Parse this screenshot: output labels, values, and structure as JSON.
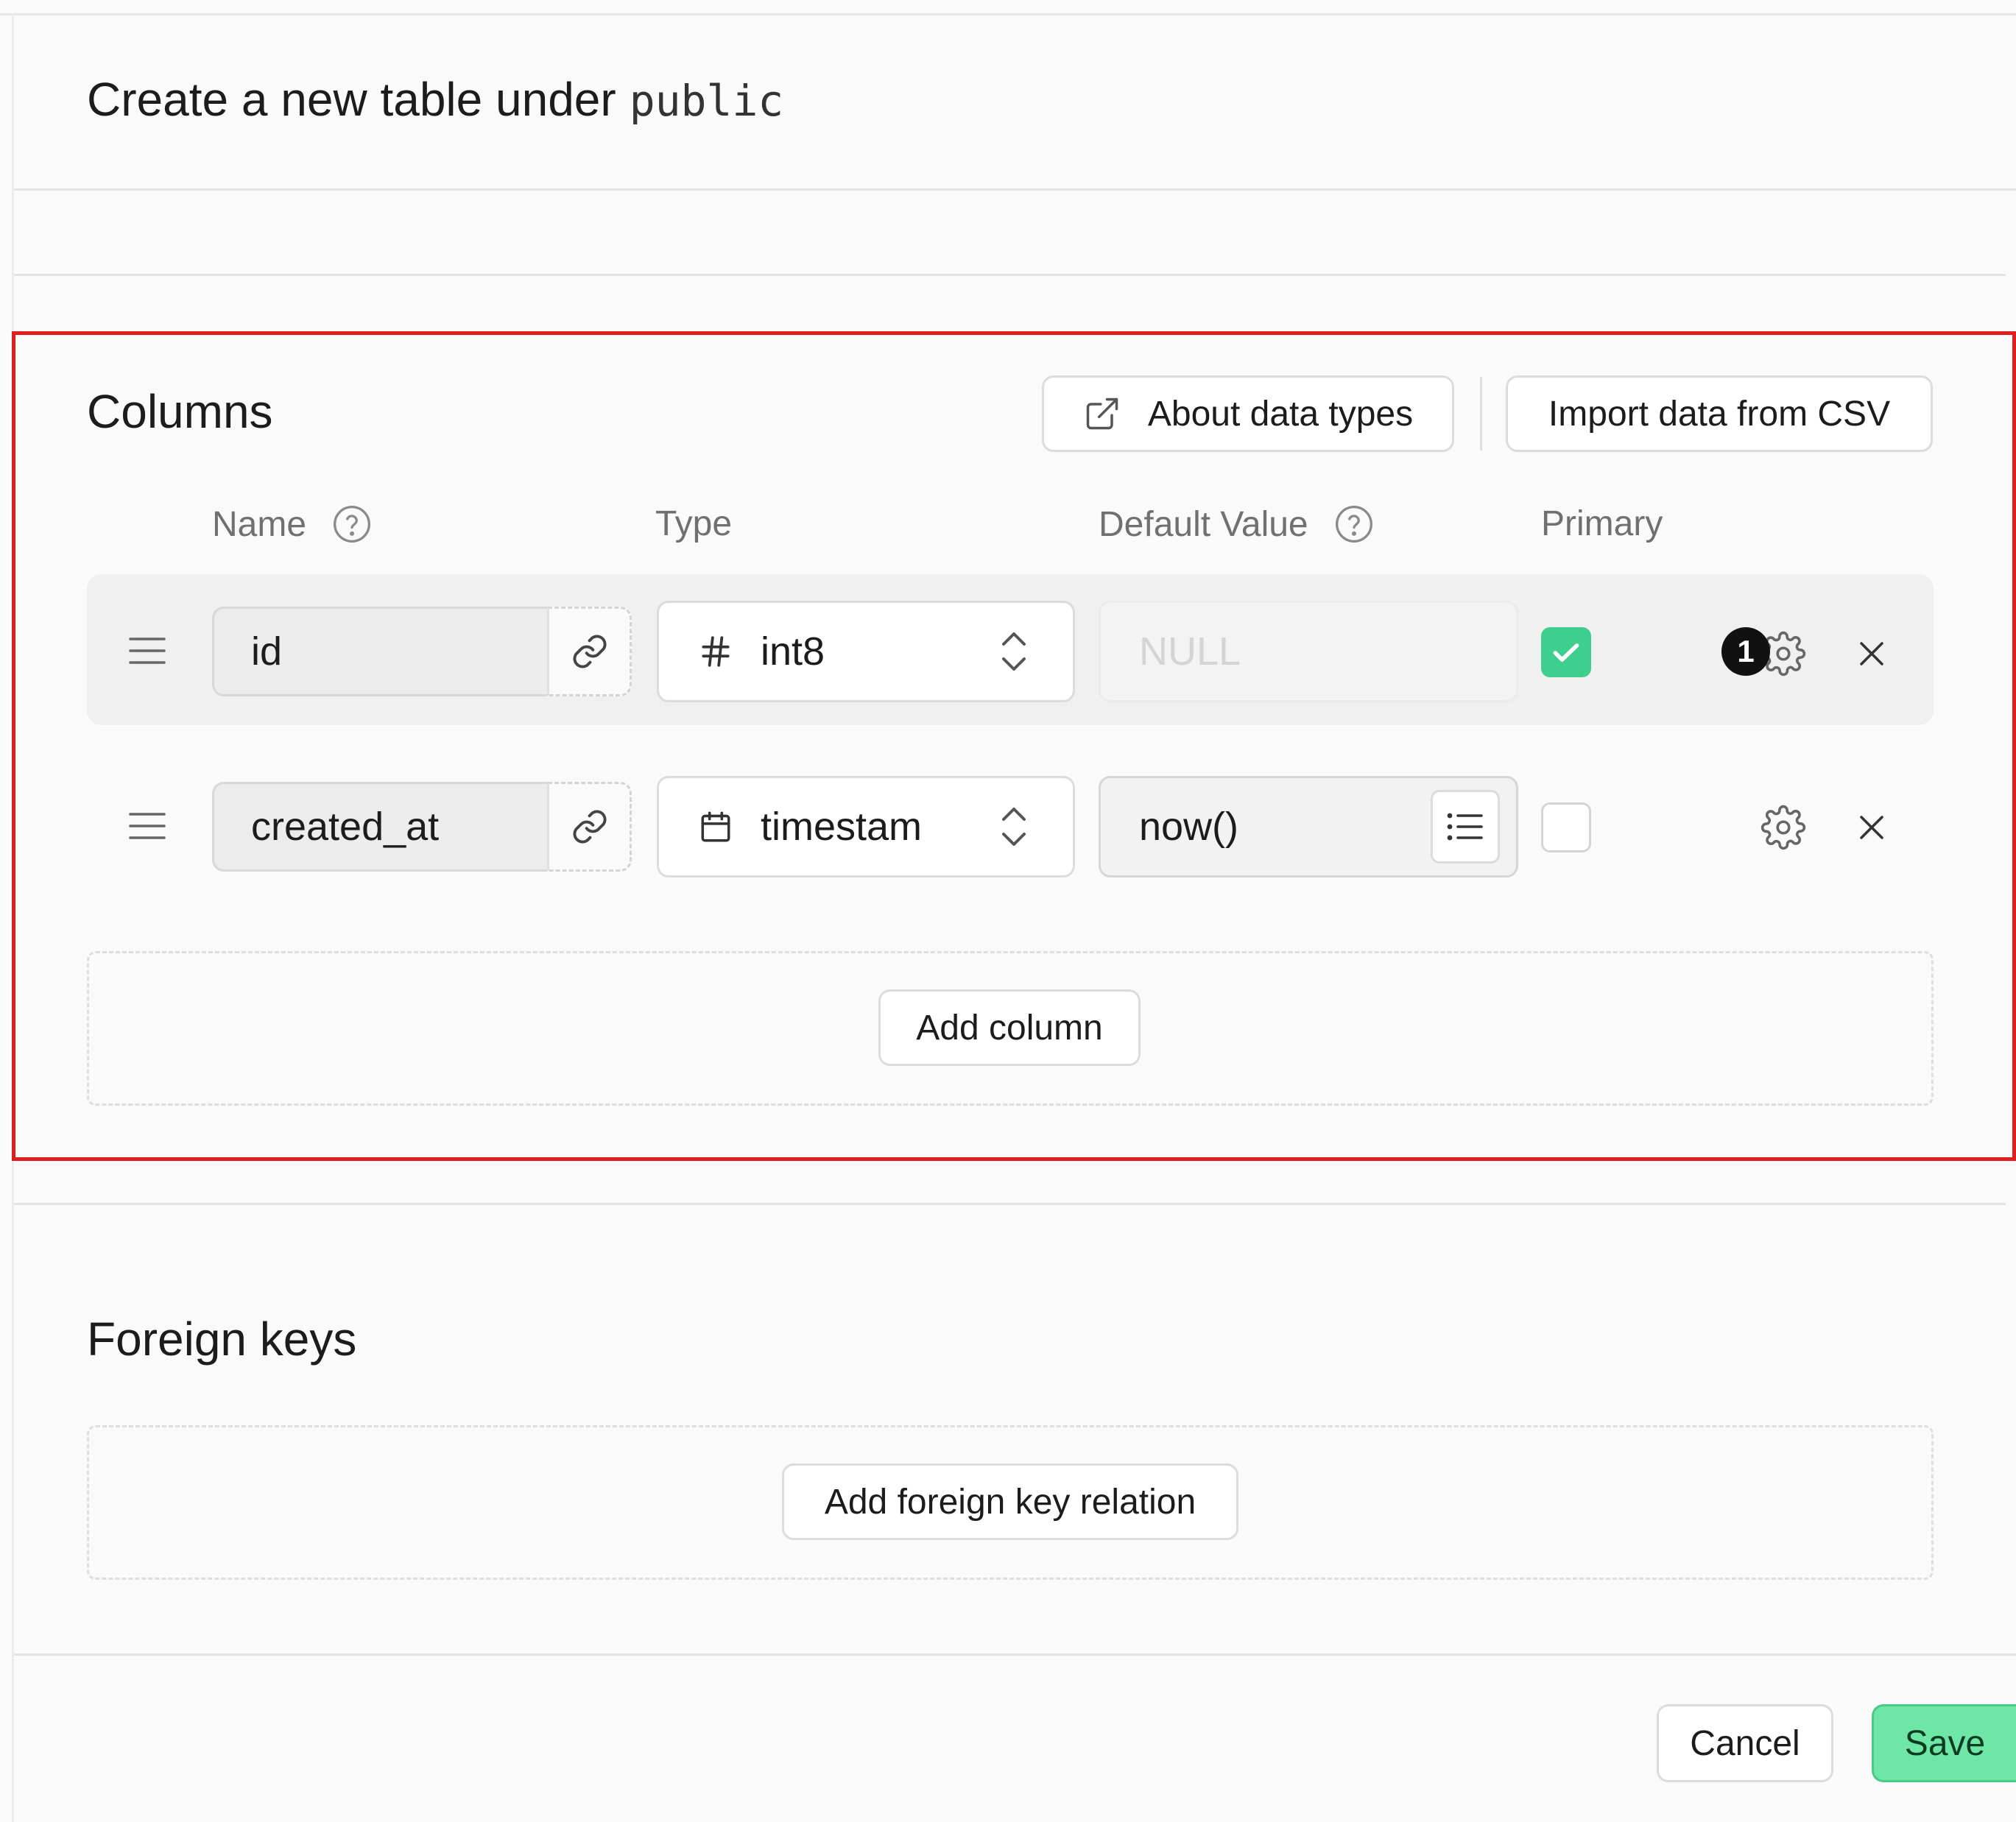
{
  "header": {
    "title": "Create a new table under",
    "schema": "public"
  },
  "columns_section": {
    "title": "Columns",
    "about_data_types_label": "About data types",
    "import_csv_label": "Import data from CSV",
    "headers": {
      "name": "Name",
      "type": "Type",
      "default_value": "Default Value",
      "primary": "Primary"
    },
    "rows": [
      {
        "name": "id",
        "type": "int8",
        "type_icon": "hash-icon",
        "default_value": "",
        "default_placeholder": "NULL",
        "primary": true,
        "settings_badge": "1"
      },
      {
        "name": "created_at",
        "type": "timestam",
        "type_icon": "calendar-icon",
        "default_value": "now()",
        "default_placeholder": "",
        "primary": false,
        "settings_badge": ""
      }
    ],
    "add_column_label": "Add column"
  },
  "foreign_keys_section": {
    "title": "Foreign keys",
    "add_relation_label": "Add foreign key relation"
  },
  "footer": {
    "cancel_label": "Cancel",
    "save_label": "Save"
  },
  "colors": {
    "accent": "#3ecf8e",
    "save_button": "#6ee7a6",
    "highlight_border": "#e11d1d"
  }
}
